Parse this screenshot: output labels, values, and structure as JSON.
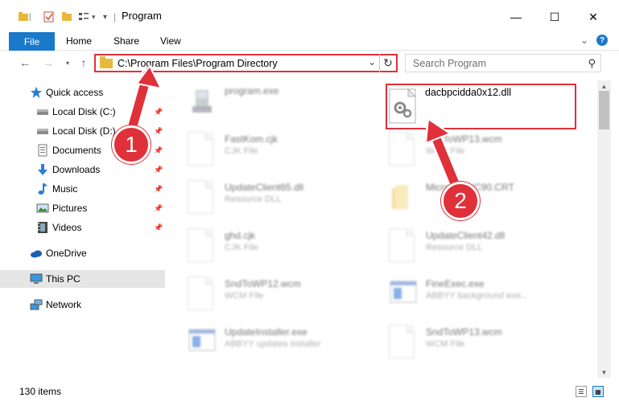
{
  "window": {
    "title": "Program"
  },
  "ribbon": {
    "tabs": [
      "File",
      "Home",
      "Share",
      "View"
    ]
  },
  "address": {
    "path": "C:\\Program Files\\Program Directory",
    "search_placeholder": "Search Program"
  },
  "sidebar": {
    "items": [
      {
        "label": "Quick access",
        "icon": "star-icon"
      },
      {
        "label": "Local Disk (C:)",
        "icon": "drive-icon"
      },
      {
        "label": "Local Disk (D:)",
        "icon": "drive-icon"
      },
      {
        "label": "Documents",
        "icon": "documents-icon"
      },
      {
        "label": "Downloads",
        "icon": "download-icon"
      },
      {
        "label": "Music",
        "icon": "music-icon"
      },
      {
        "label": "Pictures",
        "icon": "pictures-icon"
      },
      {
        "label": "Videos",
        "icon": "video-icon"
      },
      {
        "label": "OneDrive",
        "icon": "cloud-icon"
      },
      {
        "label": "This PC",
        "icon": "computer-icon"
      },
      {
        "label": "Network",
        "icon": "network-icon"
      }
    ]
  },
  "files": [
    {
      "name": "program.exe",
      "type": ""
    },
    {
      "name": "dacbpcidda0x12.dll",
      "type": ""
    },
    {
      "name": "FastKom.cjk",
      "type": "CJK File"
    },
    {
      "name": "SndToWP13.wcm",
      "type": "WCM File"
    },
    {
      "name": "UpdateClient65.dll",
      "type": "Resource DLL"
    },
    {
      "name": "Microsoft.VC90.CRT",
      "type": ""
    },
    {
      "name": "ghd.cjk",
      "type": "CJK File"
    },
    {
      "name": "UpdateClient42.dll",
      "type": "Resource DLL"
    },
    {
      "name": "SndToWP12.wcm",
      "type": "WCM File"
    },
    {
      "name": "FineExec.exe",
      "type": "ABBYY background exe..."
    },
    {
      "name": "UpdateInstaller.exe",
      "type": "ABBYY updates installer"
    },
    {
      "name": "SndToWP13.wcm",
      "type": "WCM File"
    }
  ],
  "status": {
    "count": "130 items"
  },
  "callouts": [
    "1",
    "2"
  ],
  "colors": {
    "accent": "#1979ca",
    "highlight": "#e0303a"
  }
}
